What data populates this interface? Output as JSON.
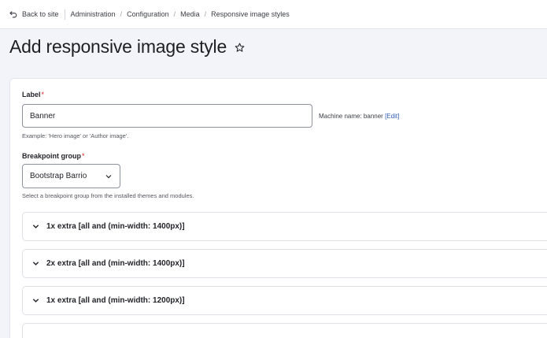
{
  "topbar": {
    "back_label": "Back to site",
    "breadcrumbs": [
      "Administration",
      "Configuration",
      "Media",
      "Responsive image styles"
    ]
  },
  "page": {
    "title": "Add responsive image style"
  },
  "form": {
    "label_field": {
      "label": "Label",
      "required_mark": "*",
      "value": "Banner",
      "description": "Example: 'Hero image' or 'Author image'."
    },
    "machine_name": {
      "prefix": "Machine name: banner",
      "edit_link": "[Edit]"
    },
    "breakpoint_group": {
      "label": "Breakpoint group",
      "required_mark": "*",
      "selected": "Bootstrap Barrio",
      "description": "Select a breakpoint group from the installed themes and modules."
    },
    "breakpoints": [
      "1x extra [all and (min-width: 1400px)]",
      "2x extra [all and (min-width: 1400px)]",
      "1x extra [all and (min-width: 1200px)]"
    ]
  },
  "colors": {
    "link": "#2f5bb6",
    "required": "#d72222",
    "page_bg": "#f3f4f9"
  }
}
